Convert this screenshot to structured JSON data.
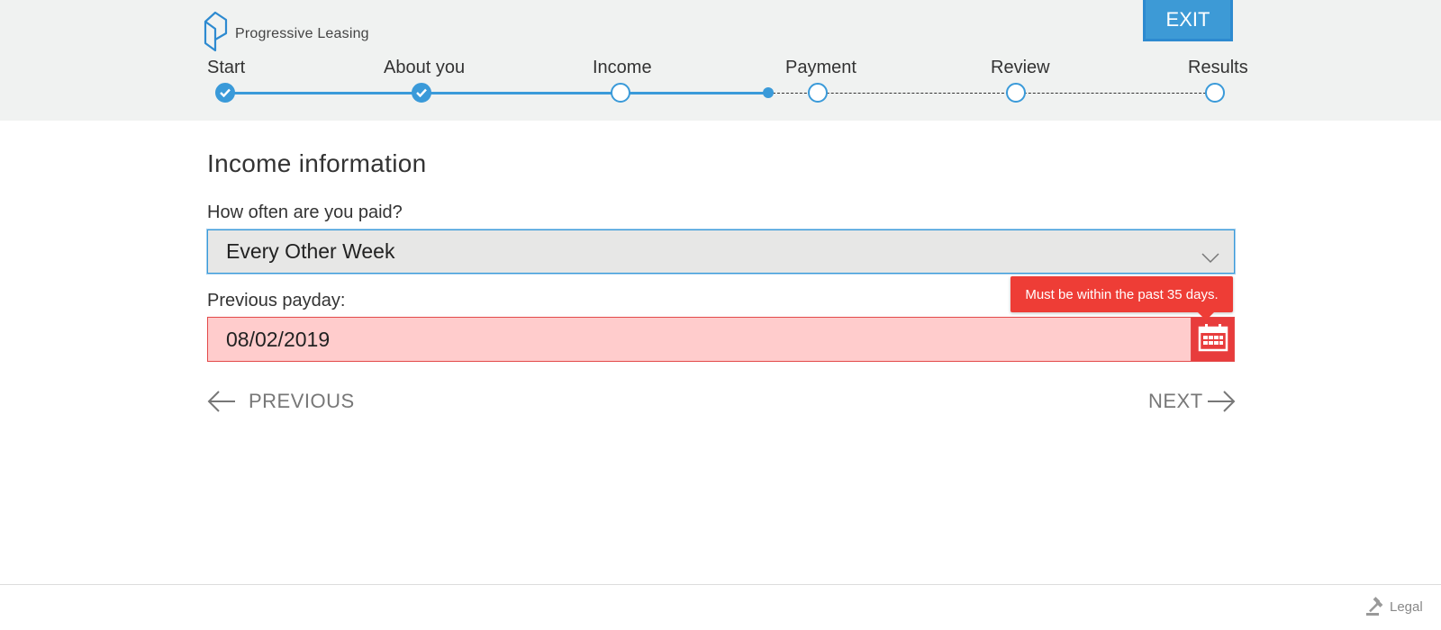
{
  "brand": {
    "name": "Progressive Leasing",
    "logo_icon": "progressive-p-logo"
  },
  "header": {
    "exit_label": "EXIT"
  },
  "steps": [
    {
      "label": "Start",
      "status": "completed"
    },
    {
      "label": "About you",
      "status": "completed"
    },
    {
      "label": "Income",
      "status": "current"
    },
    {
      "label": "Payment",
      "status": "pending"
    },
    {
      "label": "Review",
      "status": "pending"
    },
    {
      "label": "Results",
      "status": "pending"
    }
  ],
  "form": {
    "title": "Income information",
    "frequency": {
      "label": "How often are you paid?",
      "value": "Every Other Week"
    },
    "payday": {
      "label": "Previous payday:",
      "value": "08/02/2019",
      "error": "Must be within the past 35 days.",
      "calendar_icon": "calendar-icon"
    }
  },
  "nav": {
    "previous_label": "PREVIOUS",
    "next_label": "NEXT"
  },
  "footer": {
    "legal_label": "Legal",
    "legal_icon": "gavel-icon"
  },
  "colors": {
    "accent": "#3a9ad9",
    "error": "#ee3d36",
    "error_field_bg": "#ffcccc",
    "header_bg": "#f0f2f1"
  }
}
